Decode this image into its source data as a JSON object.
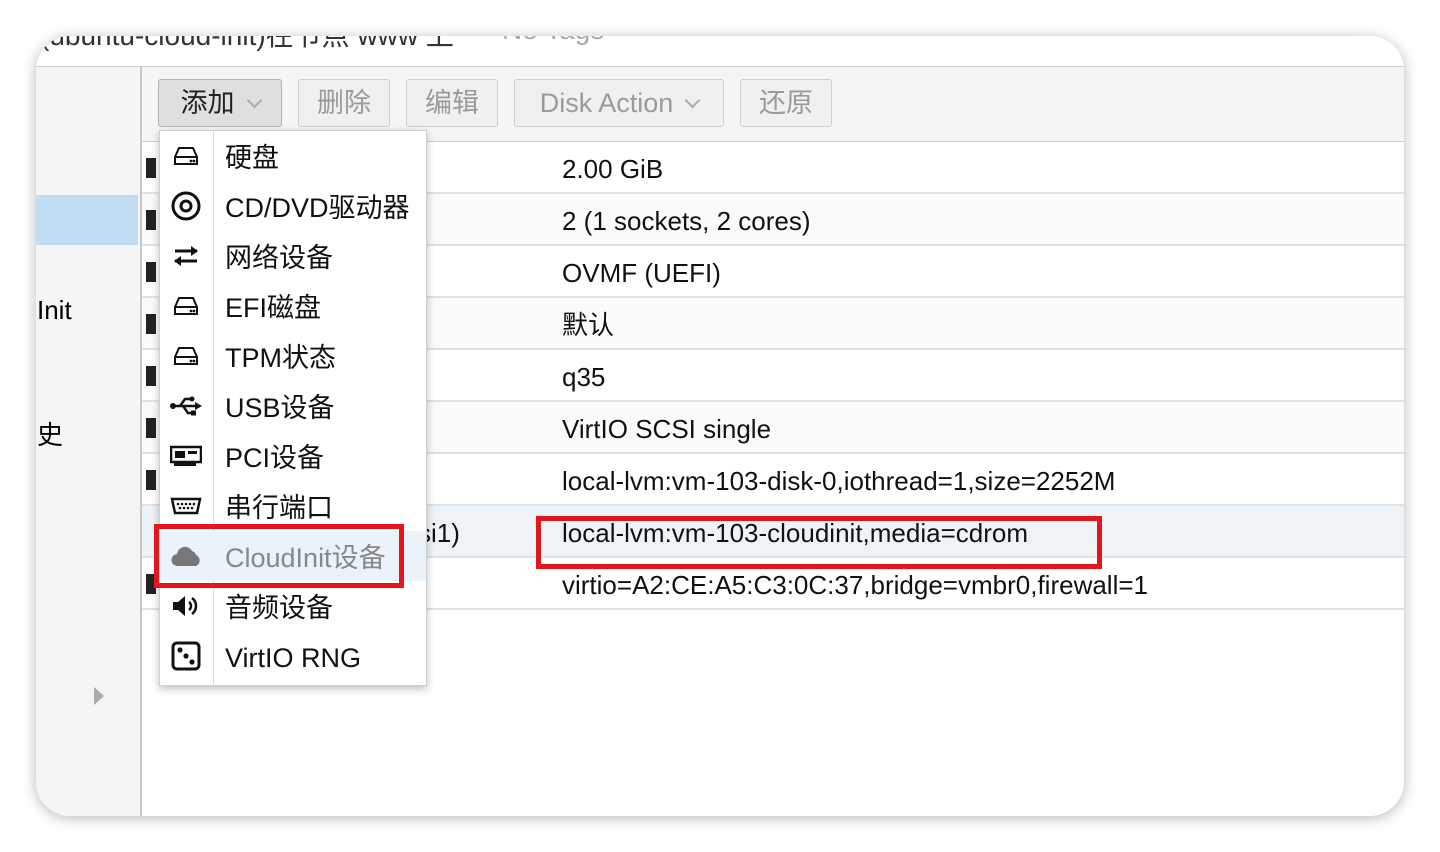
{
  "topbar": {
    "title_fragment": "(ubuntu-cloud-init)在节点 www 上",
    "tags": "No Tags"
  },
  "nav": {
    "items": [
      "Init",
      "史"
    ]
  },
  "toolbar": {
    "add_label": "添加",
    "delete_label": "删除",
    "edit_label": "编辑",
    "disk_action_label": "Disk Action",
    "revert_label": "还原"
  },
  "hardware": {
    "rows": [
      {
        "key": "",
        "value": "2.00 GiB"
      },
      {
        "key": "",
        "value": "2 (1 sockets, 2 cores)"
      },
      {
        "key": "",
        "value": "OVMF (UEFI)"
      },
      {
        "key": "",
        "value": "默认"
      },
      {
        "key": "",
        "value": "q35"
      },
      {
        "key": "",
        "value": "VirtIO SCSI single"
      },
      {
        "key": "",
        "value": "local-lvm:vm-103-disk-0,iothread=1,size=2252M"
      },
      {
        "key": "si1)",
        "value": "local-lvm:vm-103-cloudinit,media=cdrom"
      },
      {
        "key": "",
        "value": "virtio=A2:CE:A5:C3:0C:37,bridge=vmbr0,firewall=1"
      }
    ]
  },
  "add_menu": {
    "items": [
      {
        "label": "硬盘",
        "icon": "hdd-icon"
      },
      {
        "label": "CD/DVD驱动器",
        "icon": "disc-icon"
      },
      {
        "label": "网络设备",
        "icon": "exchange-icon"
      },
      {
        "label": "EFI磁盘",
        "icon": "hdd-icon"
      },
      {
        "label": "TPM状态",
        "icon": "hdd-icon"
      },
      {
        "label": "USB设备",
        "icon": "usb-icon"
      },
      {
        "label": "PCI设备",
        "icon": "pci-card-icon"
      },
      {
        "label": "串行端口",
        "icon": "serial-port-icon"
      },
      {
        "label": "CloudInit设备",
        "icon": "cloud-icon",
        "disabled": true
      },
      {
        "label": "音频设备",
        "icon": "volume-icon"
      },
      {
        "label": "VirtIO RNG",
        "icon": "dice-icon"
      }
    ]
  },
  "highlight_color": "#e4161d"
}
